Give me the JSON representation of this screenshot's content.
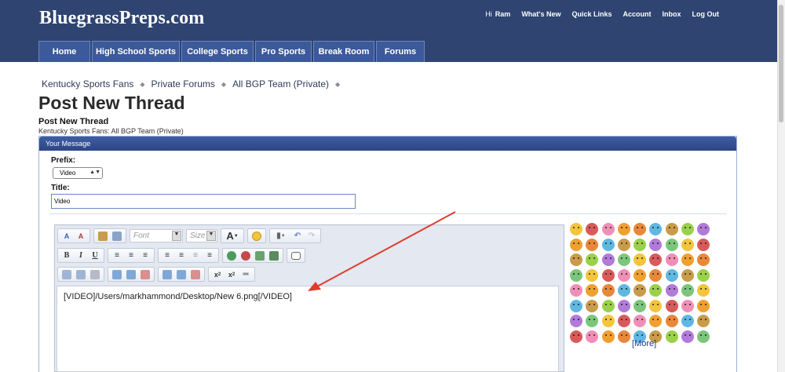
{
  "header": {
    "logo": "BluegrassPreps.com",
    "greeting": "Hi",
    "user": "Ram",
    "links": [
      "What's New",
      "Quick Links",
      "Account",
      "Inbox",
      "Log Out"
    ]
  },
  "tabs": [
    "Home",
    "High School Sports",
    "College Sports",
    "Pro Sports",
    "Break Room",
    "Forums"
  ],
  "breadcrumb": [
    "Kentucky Sports Fans",
    "Private Forums",
    "All BGP Team (Private)"
  ],
  "page_title": "Post New Thread",
  "section": {
    "title": "Post New Thread",
    "description": "Kentucky Sports Fans: All BGP Team (Private)",
    "panel_header": "Your Message"
  },
  "form": {
    "prefix_label": "Prefix:",
    "prefix_value": "Video",
    "title_label": "Title:",
    "title_value": "Video"
  },
  "editor": {
    "font_placeholder": "Font",
    "size_placeholder": "Size",
    "content": "[VIDEO]/Users/markhammond/Desktop/New 6.png[/VIDEO]"
  },
  "smilies": {
    "more_label": "[More]"
  },
  "colors": {
    "header_bg": "#2f4470",
    "tab_bg": "#3c5a99",
    "arrow": "#e03c2c"
  }
}
